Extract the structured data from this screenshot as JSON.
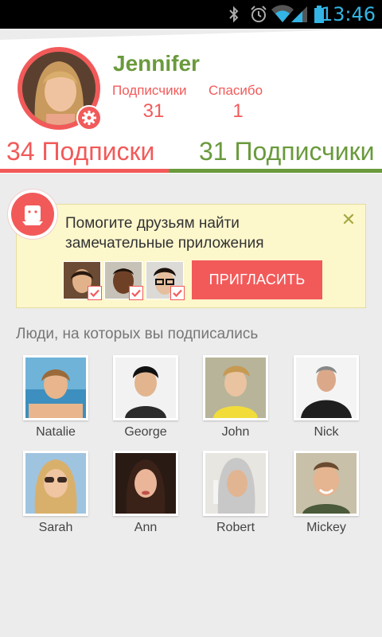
{
  "status_bar": {
    "time": "13:46",
    "icons": [
      "bluetooth-icon",
      "alarm-icon",
      "wifi-icon",
      "signal-icon",
      "battery-icon"
    ]
  },
  "profile": {
    "name": "Jennifer",
    "followers_label": "Подписчики",
    "followers_count": "31",
    "thanks_label": "Спасибо",
    "thanks_count": "1"
  },
  "counts": {
    "following_number": "34",
    "following_label": "Подписки",
    "followers_number": "31",
    "followers_label": "Подписчики"
  },
  "invite": {
    "text": "Помогите друзьям найти замечательные приложения",
    "button_label": "ПРИГЛАСИТЬ",
    "close_symbol": "✕"
  },
  "people_section": {
    "title": "Люди, на которых вы подписались",
    "people": [
      {
        "name": "Natalie"
      },
      {
        "name": "George"
      },
      {
        "name": "John"
      },
      {
        "name": "Nick"
      },
      {
        "name": "Sarah"
      },
      {
        "name": "Ann"
      },
      {
        "name": "Robert"
      },
      {
        "name": "Mickey"
      }
    ]
  },
  "colors": {
    "accent_red": "#f25a5a",
    "accent_green": "#6a9a3c",
    "status_blue": "#33b5e5",
    "card_yellow": "#fdf7cc"
  }
}
